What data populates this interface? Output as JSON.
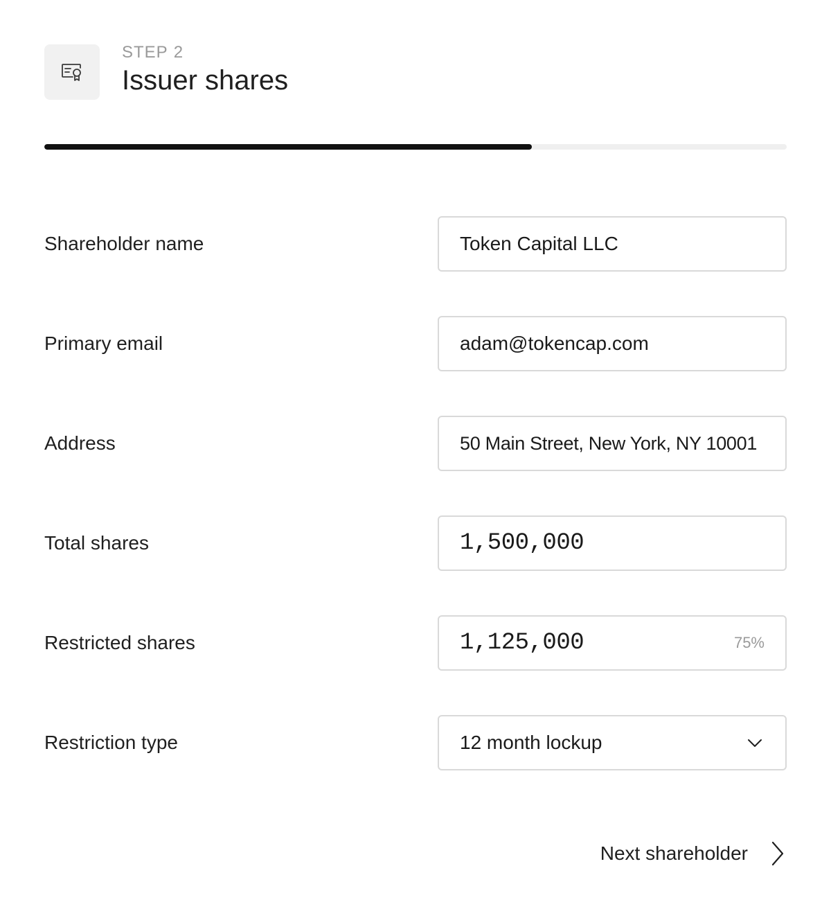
{
  "header": {
    "step_word": "STEP",
    "step_number": "2",
    "title": "Issuer shares",
    "icon": "certificate-icon"
  },
  "progress": {
    "fraction": 0.657
  },
  "form": {
    "shareholder_name": {
      "label": "Shareholder name",
      "value": "Token Capital LLC"
    },
    "primary_email": {
      "label": "Primary email",
      "value": "adam@tokencap.com"
    },
    "address": {
      "label": "Address",
      "value": "50 Main Street, New York, NY 10001"
    },
    "total_shares": {
      "label": "Total shares",
      "value": "1,500,000"
    },
    "restricted_shares": {
      "label": "Restricted shares",
      "value": "1,125,000",
      "percent": "75%"
    },
    "restriction_type": {
      "label": "Restriction type",
      "value": "12 month lockup",
      "icon": "chevron-down-icon"
    }
  },
  "footer": {
    "next_label": "Next shareholder",
    "icon": "chevron-right-icon"
  }
}
